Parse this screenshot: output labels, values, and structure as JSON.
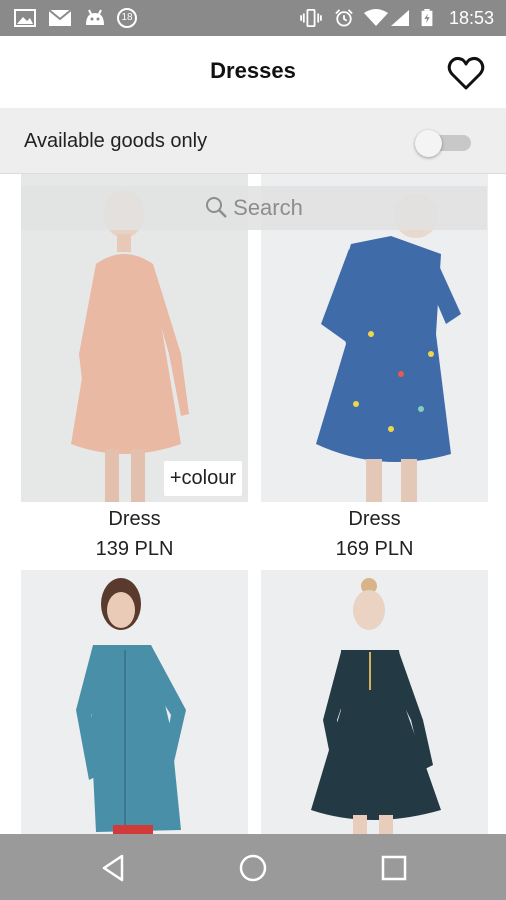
{
  "status_bar": {
    "time": "18:53",
    "notification_count": "18",
    "icons": [
      "image-icon",
      "mail-icon",
      "android-icon",
      "vibrate-icon",
      "alarm-icon",
      "wifi-icon",
      "signal-icon",
      "battery-icon"
    ]
  },
  "toolbar": {
    "title": "Dresses",
    "favorite_icon": "heart-icon"
  },
  "filter": {
    "label": "Available goods only",
    "toggle_on": false
  },
  "search": {
    "placeholder": "Search"
  },
  "products": [
    {
      "name": "Dress",
      "price": "139 PLN",
      "colour_label": "+colour",
      "color": "#e9b9a4"
    },
    {
      "name": "Dress",
      "price": "169 PLN",
      "color": "#3f6ba8"
    },
    {
      "name": "",
      "price": "",
      "color": "#4a8fa8"
    },
    {
      "name": "",
      "price": "",
      "color": "#233a45"
    }
  ],
  "nav": {
    "icons": [
      "back-icon",
      "home-icon",
      "recents-icon"
    ]
  },
  "colors": {
    "status_bar": "#8a8a8a",
    "filter_bg": "#eeeeee",
    "nav_bar": "#9a9a9a"
  }
}
